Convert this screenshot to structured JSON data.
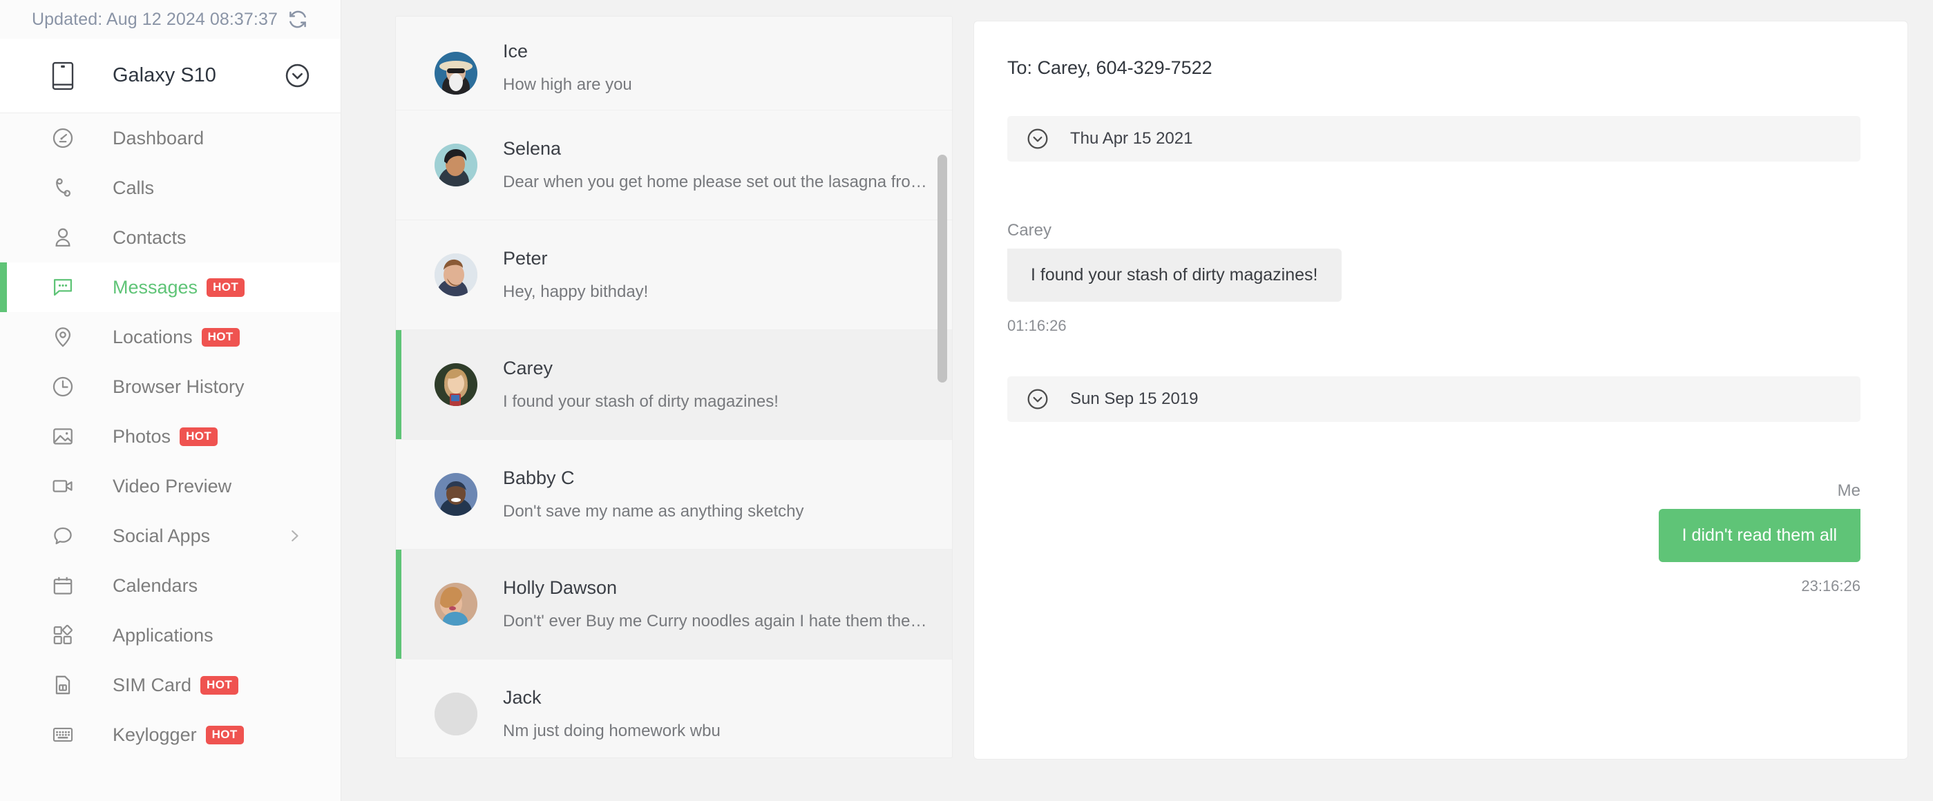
{
  "sidebar": {
    "updated_label": "Updated: Aug 12 2024 08:37:37",
    "refresh_icon": "refresh-icon",
    "device": {
      "name": "Galaxy S10",
      "icon": "phone-icon",
      "caret_icon": "chevron-down-circle-icon"
    },
    "items": [
      {
        "label": "Dashboard",
        "icon": "dashboard-icon",
        "badge": "",
        "active": false,
        "chevron": false
      },
      {
        "label": "Calls",
        "icon": "phone-call-icon",
        "badge": "",
        "active": false,
        "chevron": false
      },
      {
        "label": "Contacts",
        "icon": "contacts-icon",
        "badge": "",
        "active": false,
        "chevron": false
      },
      {
        "label": "Messages",
        "icon": "message-icon",
        "badge": "HOT",
        "active": true,
        "chevron": false
      },
      {
        "label": "Locations",
        "icon": "location-pin-icon",
        "badge": "HOT",
        "active": false,
        "chevron": false
      },
      {
        "label": "Browser History",
        "icon": "clock-icon",
        "badge": "",
        "active": false,
        "chevron": false
      },
      {
        "label": "Photos",
        "icon": "photo-icon",
        "badge": "HOT",
        "active": false,
        "chevron": false
      },
      {
        "label": "Video Preview",
        "icon": "video-camera-icon",
        "badge": "",
        "active": false,
        "chevron": false
      },
      {
        "label": "Social Apps",
        "icon": "chat-bubble-icon",
        "badge": "",
        "active": false,
        "chevron": true
      },
      {
        "label": "Calendars",
        "icon": "calendar-icon",
        "badge": "",
        "active": false,
        "chevron": false
      },
      {
        "label": "Applications",
        "icon": "applications-icon",
        "badge": "",
        "active": false,
        "chevron": false
      },
      {
        "label": "SIM Card",
        "icon": "sim-card-icon",
        "badge": "HOT",
        "active": false,
        "chevron": false
      },
      {
        "label": "Keylogger",
        "icon": "keyboard-icon",
        "badge": "HOT",
        "active": false,
        "chevron": false
      }
    ]
  },
  "message_list": {
    "rows": [
      {
        "name": "Ice",
        "snippet": "How high are you",
        "unread": false,
        "avatar": "avatar-ice"
      },
      {
        "name": "Selena",
        "snippet": "Dear when you get home please set out the lasagna from the …",
        "unread": false,
        "avatar": "avatar-selena"
      },
      {
        "name": "Peter",
        "snippet": "Hey, happy bithday!",
        "unread": false,
        "avatar": "avatar-peter"
      },
      {
        "name": "Carey",
        "snippet": "I found your stash of dirty magazines!",
        "unread": true,
        "avatar": "avatar-carey"
      },
      {
        "name": "Babby C",
        "snippet": "Don't save my name as anything sketchy",
        "unread": false,
        "avatar": "avatar-babby"
      },
      {
        "name": "Holly Dawson",
        "snippet": "Don't' ever Buy me Curry noodles again I hate them they're to…",
        "unread": true,
        "avatar": "avatar-holly"
      },
      {
        "name": "Jack",
        "snippet": "Nm just doing homework wbu",
        "unread": false,
        "avatar": "avatar-placeholder"
      }
    ]
  },
  "conversation": {
    "title": "To: Carey, 604-329-7522",
    "groups": [
      {
        "date": "Thu Apr 15 2021",
        "sender": "Carey",
        "text": "I found your stash of dirty magazines!",
        "time": "01:16:26",
        "direction": "incoming"
      },
      {
        "date": "Sun Sep 15 2019",
        "sender": "Me",
        "text": "I didn't read them all",
        "time": "23:16:26",
        "direction": "outgoing"
      }
    ]
  },
  "colors": {
    "accent_green": "#5fc477",
    "badge_red": "#ef5350",
    "page_bg": "#f2f2f2"
  }
}
